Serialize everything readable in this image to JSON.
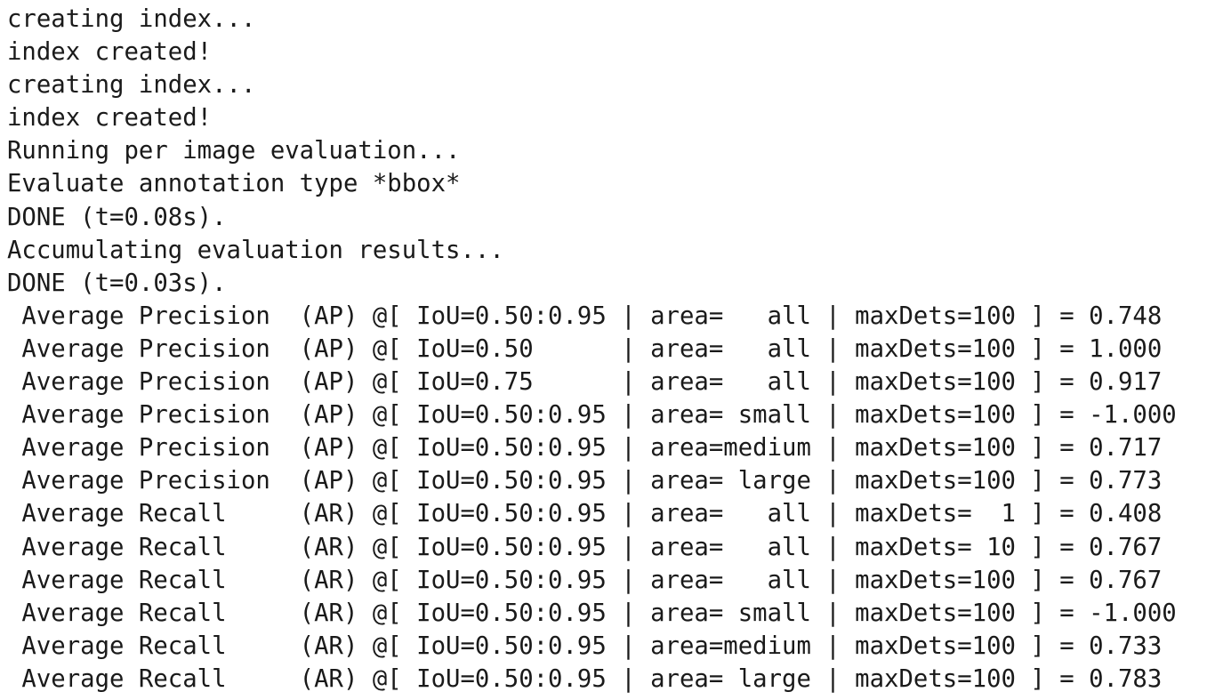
{
  "output": {
    "lines": [
      "creating index...",
      "index created!",
      "creating index...",
      "index created!",
      "Running per image evaluation...",
      "Evaluate annotation type *bbox*",
      "DONE (t=0.08s).",
      "Accumulating evaluation results...",
      "DONE (t=0.03s).",
      " Average Precision  (AP) @[ IoU=0.50:0.95 | area=   all | maxDets=100 ] = 0.748",
      " Average Precision  (AP) @[ IoU=0.50      | area=   all | maxDets=100 ] = 1.000",
      " Average Precision  (AP) @[ IoU=0.75      | area=   all | maxDets=100 ] = 0.917",
      " Average Precision  (AP) @[ IoU=0.50:0.95 | area= small | maxDets=100 ] = -1.000",
      " Average Precision  (AP) @[ IoU=0.50:0.95 | area=medium | maxDets=100 ] = 0.717",
      " Average Precision  (AP) @[ IoU=0.50:0.95 | area= large | maxDets=100 ] = 0.773",
      " Average Recall     (AR) @[ IoU=0.50:0.95 | area=   all | maxDets=  1 ] = 0.408",
      " Average Recall     (AR) @[ IoU=0.50:0.95 | area=   all | maxDets= 10 ] = 0.767",
      " Average Recall     (AR) @[ IoU=0.50:0.95 | area=   all | maxDets=100 ] = 0.767",
      " Average Recall     (AR) @[ IoU=0.50:0.95 | area= small | maxDets=100 ] = -1.000",
      " Average Recall     (AR) @[ IoU=0.50:0.95 | area=medium | maxDets=100 ] = 0.733",
      " Average Recall     (AR) @[ IoU=0.50:0.95 | area= large | maxDets=100 ] = 0.783"
    ]
  }
}
